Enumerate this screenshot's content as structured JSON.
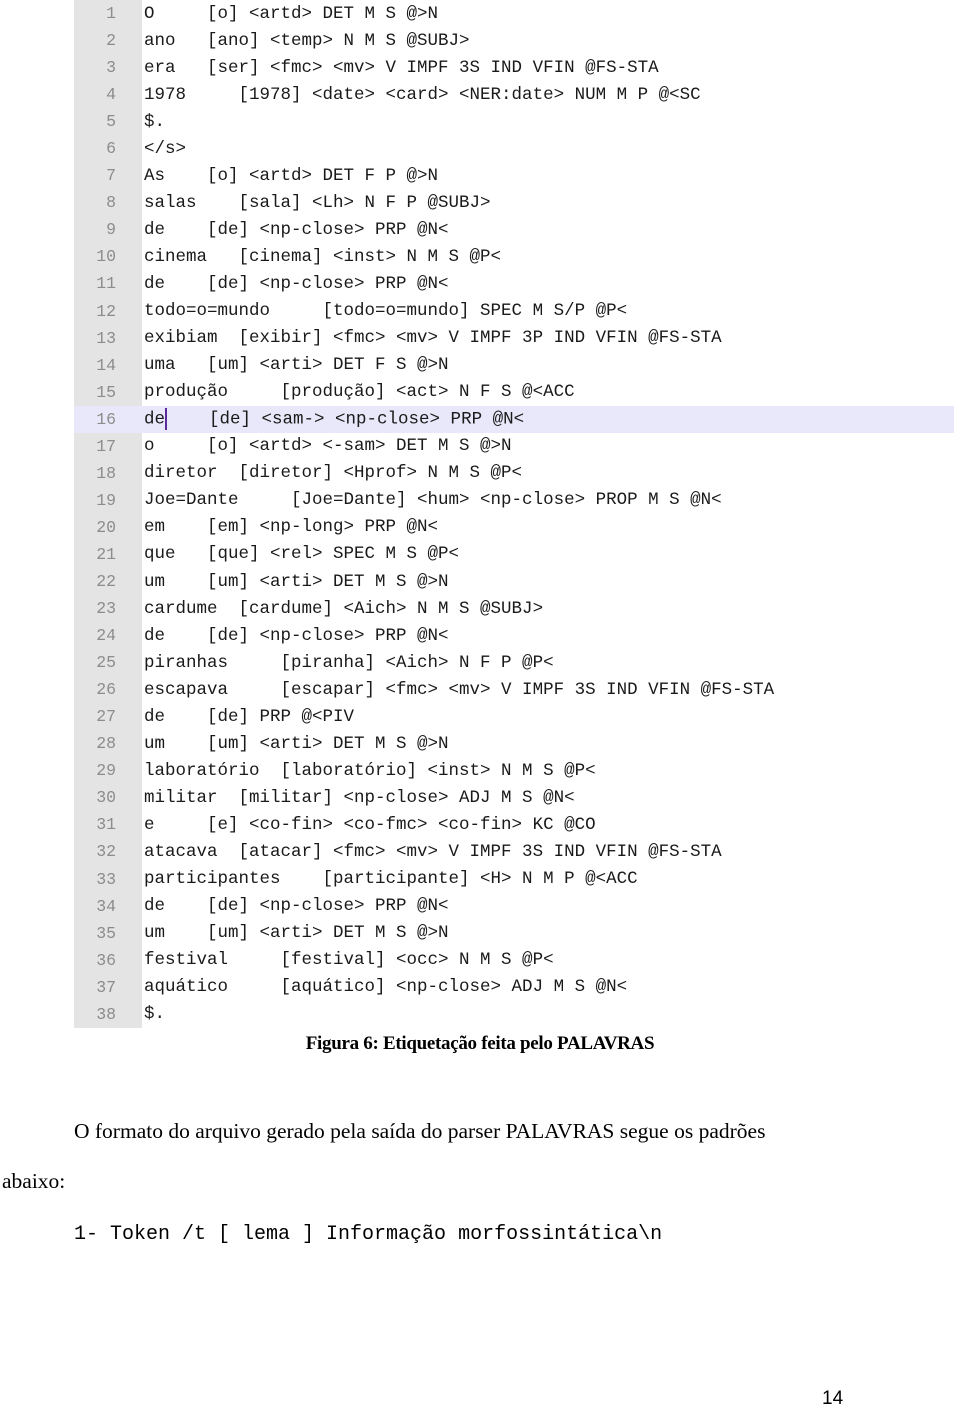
{
  "figure": {
    "editor": {
      "highlighted_line": 16,
      "caret_after_token_on_line": 16,
      "lines": [
        {
          "n": "1",
          "text": "O     [o] <artd> DET M S @>N"
        },
        {
          "n": "2",
          "text": "ano   [ano] <temp> N M S @SUBJ>"
        },
        {
          "n": "3",
          "text": "era   [ser] <fmc> <mv> V IMPF 3S IND VFIN @FS-STA"
        },
        {
          "n": "4",
          "text": "1978     [1978] <date> <card> <NER:date> NUM M P @<SC"
        },
        {
          "n": "5",
          "text": "$."
        },
        {
          "n": "6",
          "text": "</s>"
        },
        {
          "n": "7",
          "text": "As    [o] <artd> DET F P @>N"
        },
        {
          "n": "8",
          "text": "salas    [sala] <Lh> N F P @SUBJ>"
        },
        {
          "n": "9",
          "text": "de    [de] <np-close> PRP @N<"
        },
        {
          "n": "10",
          "text": "cinema   [cinema] <inst> N M S @P<"
        },
        {
          "n": "11",
          "text": "de    [de] <np-close> PRP @N<"
        },
        {
          "n": "12",
          "text": "todo=o=mundo     [todo=o=mundo] SPEC M S/P @P<"
        },
        {
          "n": "13",
          "text": "exibiam  [exibir] <fmc> <mv> V IMPF 3P IND VFIN @FS-STA"
        },
        {
          "n": "14",
          "text": "uma   [um] <arti> DET F S @>N"
        },
        {
          "n": "15",
          "text": "produção     [produção] <act> N F S @<ACC"
        },
        {
          "n": "16",
          "text_before_caret": "de",
          "text": "    [de] <sam-> <np-close> PRP @N<"
        },
        {
          "n": "17",
          "text": "o     [o] <artd> <-sam> DET M S @>N"
        },
        {
          "n": "18",
          "text": "diretor  [diretor] <Hprof> N M S @P<"
        },
        {
          "n": "19",
          "text": "Joe=Dante     [Joe=Dante] <hum> <np-close> PROP M S @N<"
        },
        {
          "n": "20",
          "text": "em    [em] <np-long> PRP @N<"
        },
        {
          "n": "21",
          "text": "que   [que] <rel> SPEC M S @P<"
        },
        {
          "n": "22",
          "text": "um    [um] <arti> DET M S @>N"
        },
        {
          "n": "23",
          "text": "cardume  [cardume] <Aich> N M S @SUBJ>"
        },
        {
          "n": "24",
          "text": "de    [de] <np-close> PRP @N<"
        },
        {
          "n": "25",
          "text": "piranhas     [piranha] <Aich> N F P @P<"
        },
        {
          "n": "26",
          "text": "escapava     [escapar] <fmc> <mv> V IMPF 3S IND VFIN @FS-STA"
        },
        {
          "n": "27",
          "text": "de    [de] PRP @<PIV"
        },
        {
          "n": "28",
          "text": "um    [um] <arti> DET M S @>N"
        },
        {
          "n": "29",
          "text": "laboratório  [laboratório] <inst> N M S @P<"
        },
        {
          "n": "30",
          "text": "militar  [militar] <np-close> ADJ M S @N<"
        },
        {
          "n": "31",
          "text": "e     [e] <co-fin> <co-fmc> <co-fin> KC @CO"
        },
        {
          "n": "32",
          "text": "atacava  [atacar] <fmc> <mv> V IMPF 3S IND VFIN @FS-STA"
        },
        {
          "n": "33",
          "text": "participantes    [participante] <H> N M P @<ACC"
        },
        {
          "n": "34",
          "text": "de    [de] <np-close> PRP @N<"
        },
        {
          "n": "35",
          "text": "um    [um] <arti> DET M S @>N"
        },
        {
          "n": "36",
          "text": "festival     [festival] <occ> N M S @P<"
        },
        {
          "n": "37",
          "text": "aquático     [aquático] <np-close> ADJ M S @N<"
        },
        {
          "n": "38",
          "text": "$."
        }
      ]
    },
    "caption": "Figura 6: Etiquetação feita pelo PALAVRAS"
  },
  "body": {
    "paragraph_line1": "O formato do arquivo gerado pela saída do parser PALAVRAS segue os padrões",
    "paragraph_line2": "abaixo:",
    "format_line": "1- Token /t [ lema ] Informação morfossintática\\n"
  },
  "footer": {
    "page_number": "14"
  },
  "colors": {
    "gutter_bg": "#e4e4e4",
    "line_number": "#8c8c8c",
    "highlight_bg": "#e8e8fa",
    "caret": "#5a2a9a"
  }
}
